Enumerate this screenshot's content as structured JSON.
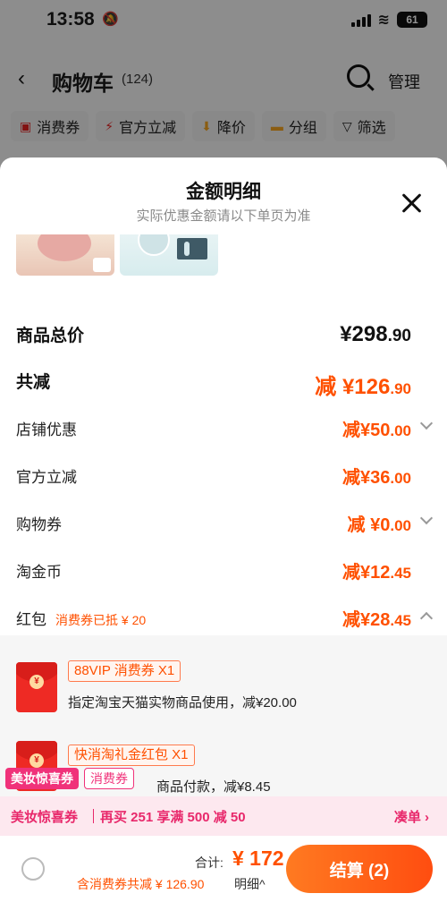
{
  "status_bar": {
    "time": "13:58",
    "battery": "61"
  },
  "nav": {
    "back": "‹",
    "title": "购物车",
    "count": "(124)",
    "manage": "管理"
  },
  "filters": [
    {
      "label": "消费券",
      "icon": "coupon-icon"
    },
    {
      "label": "官方立减",
      "icon": "lightning-icon"
    },
    {
      "label": "降价",
      "icon": "price-down-icon"
    },
    {
      "label": "分组",
      "icon": "folder-icon"
    },
    {
      "label": "筛选",
      "icon": "filter-icon"
    }
  ],
  "sheet": {
    "title": "金额明细",
    "subtitle": "实际优惠金额请以下单页为准",
    "rows": {
      "total_price": {
        "label": "商品总价",
        "value": "¥298",
        "dec": ".90"
      },
      "total_reduce": {
        "label": "共减",
        "value": "减 ¥126",
        "dec": ".90"
      },
      "shop_discount": {
        "label": "店铺优惠",
        "value": "减¥50",
        "dec": ".00"
      },
      "official": {
        "label": "官方立减",
        "value": "减¥36",
        "dec": ".00"
      },
      "shopping_coupon": {
        "label": "购物券",
        "value": "减 ¥0",
        "dec": ".00"
      },
      "taojinbi": {
        "label": "淘金币",
        "value": "减¥12",
        "dec": ".45"
      },
      "hongbao": {
        "label": "红包",
        "note": "消费券已抵 ¥ 20",
        "value": "减¥28",
        "dec": ".45"
      }
    },
    "coupons": [
      {
        "tag": "88VIP 消费券 X1",
        "desc": "指定淘宝天猫实物商品使用，减¥20.00"
      },
      {
        "tag": "快消淘礼金红包 X1",
        "desc": "商品付款，减¥8.45"
      }
    ]
  },
  "promo": {
    "badge1": "美妆惊喜券",
    "badge2": "消费券",
    "name": "美妆惊喜券",
    "text": "再买 251 享满 500 减 50",
    "cta": "凑单 ›"
  },
  "bottom": {
    "total_label": "合计:",
    "total_value": "¥ 172",
    "note": "含消费券共减 ¥ 126.90",
    "detail": "明细^",
    "checkout": "结算 (2)"
  },
  "colors": {
    "accent": "#ff5000",
    "promo": "#e8286b"
  }
}
